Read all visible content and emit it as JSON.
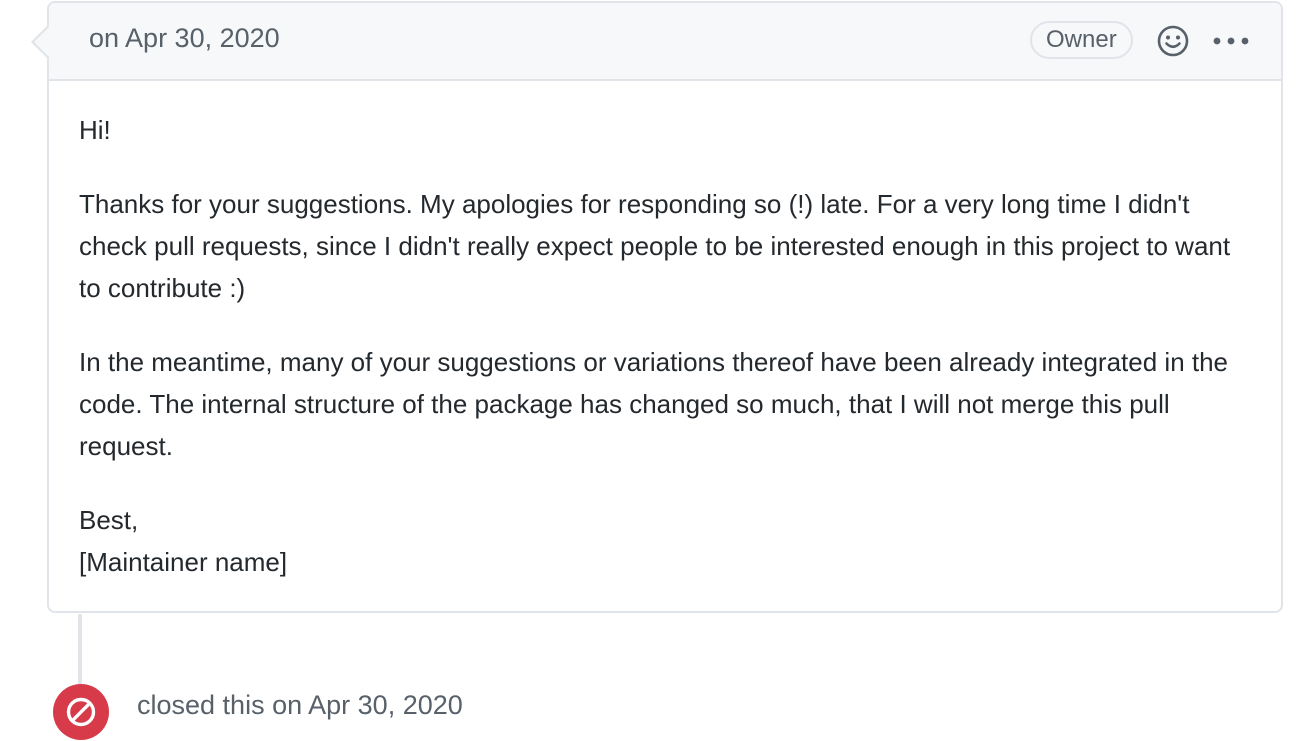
{
  "comment": {
    "date": "on Apr 30, 2020",
    "role_badge": "Owner",
    "reaction_icon": "smiley-icon",
    "more_icon": "kebab-horizontal-icon",
    "body": {
      "greeting": "Hi!",
      "paragraph1": "Thanks for your suggestions. My apologies for responding so (!) late. For a very long time I didn't check pull requests, since I didn't really expect people to be interested enough in this project to want to contribute :)",
      "paragraph2": "In the meantime, many of your suggestions or variations thereof have been already integrated in the code. The internal structure of the package has changed so much, that I will not merge this pull request.",
      "signoff": "Best,",
      "signature": "[Maintainer name]"
    }
  },
  "event": {
    "icon": "circle-slash-icon",
    "action": "closed this",
    "date": "on Apr 30, 2020",
    "color": "#d73a49"
  },
  "colors": {
    "border": "#e1e4e8",
    "header_bg": "#f6f8fa",
    "muted_text": "#586069",
    "text": "#24292e"
  }
}
